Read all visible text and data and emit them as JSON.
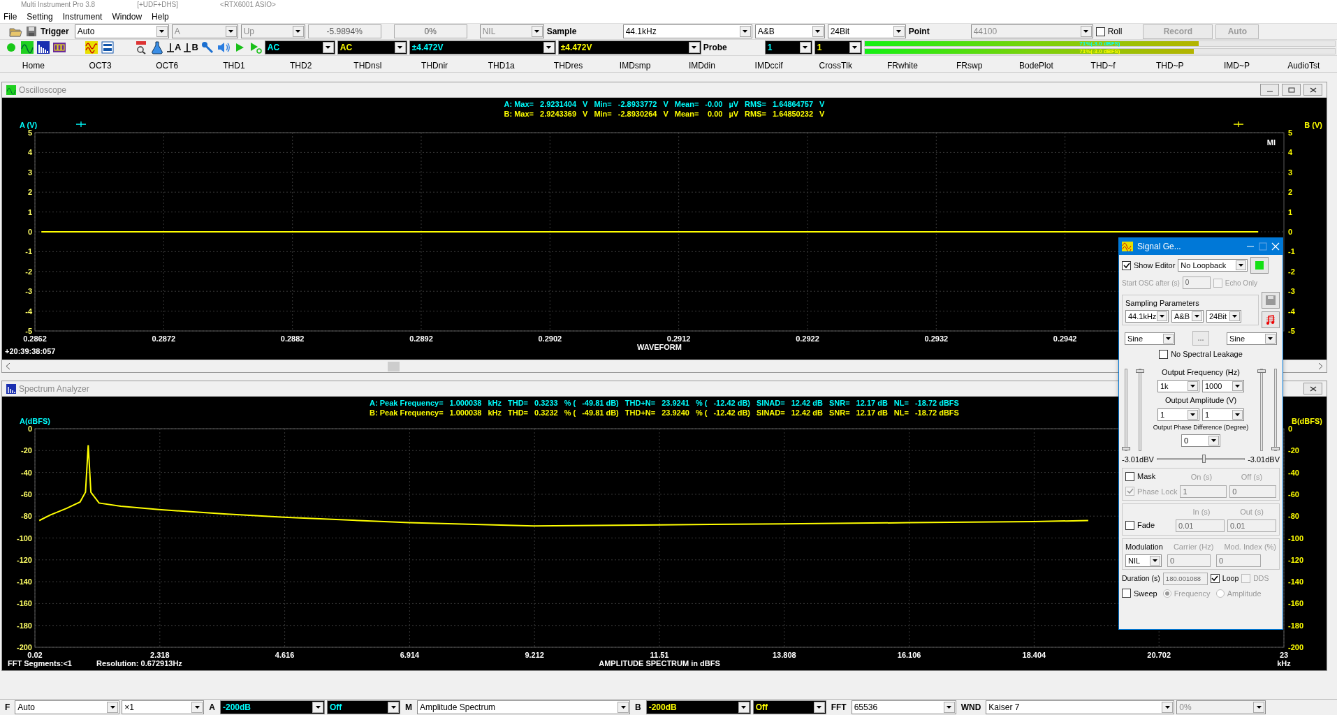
{
  "title_bar": {
    "title": "Multi Instrument Pro 3.8",
    "options": "[+UDF+DHS]",
    "device": "<RTX6001 ASIO>"
  },
  "menu": [
    "File",
    "Setting",
    "Instrument",
    "Window",
    "Help"
  ],
  "toolbar": {
    "trigger_label": "Trigger",
    "items": [
      {
        "kind": "select",
        "value": "Auto",
        "disabled": false
      },
      {
        "kind": "select",
        "value": "A",
        "disabled": true
      },
      {
        "kind": "select",
        "value": "Up",
        "disabled": true
      },
      {
        "kind": "spin",
        "value": "-5.9894%"
      },
      {
        "kind": "spin",
        "value": "0%"
      },
      {
        "kind": "select",
        "value": "NIL",
        "disabled": true
      },
      {
        "kind": "label",
        "value": "Sample"
      },
      {
        "kind": "select",
        "value": "44.1kHz",
        "disabled": false
      },
      {
        "kind": "select",
        "value": "A&B",
        "disabled": false
      },
      {
        "kind": "select",
        "value": "24Bit",
        "disabled": false
      },
      {
        "kind": "label",
        "value": "Point"
      },
      {
        "kind": "select",
        "value": "44100",
        "disabled": true
      }
    ],
    "roll": {
      "label": "Roll",
      "checked": false
    },
    "buttons": [
      {
        "label": "Record",
        "disabled": true
      },
      {
        "label": "Auto",
        "disabled": true
      }
    ]
  },
  "toolbar2": {
    "icons": [
      {
        "kind": "record"
      },
      {
        "kind": "scope"
      },
      {
        "kind": "spectrum"
      },
      {
        "kind": "meter"
      },
      {
        "kind": "generator"
      },
      {
        "kind": "dut"
      },
      {
        "kind": "ddp"
      },
      {
        "kind": "flask"
      },
      {
        "kind": "ground",
        "label": "A"
      },
      {
        "kind": "ground",
        "label": "B"
      },
      {
        "kind": "tool"
      },
      {
        "kind": "speaker"
      },
      {
        "kind": "play"
      },
      {
        "kind": "step"
      }
    ],
    "selects": [
      {
        "value": "AC",
        "color": "#00ffff"
      },
      {
        "value": "AC",
        "color": "#ffff00"
      },
      {
        "value": "±4.472V",
        "color": "#00ffff"
      },
      {
        "value": "±4.472V",
        "color": "#ffff00"
      }
    ],
    "probe_label": "Probe",
    "probes": [
      {
        "value": "1",
        "color": "#00ffff"
      },
      {
        "value": "1",
        "color": "#ffff00"
      }
    ],
    "meters": [
      {
        "level": 0.71,
        "reading": "71%(-3.0 dBFS)",
        "color": "#00ffff"
      },
      {
        "level": 0.7,
        "reading": "71%(-3.0 dBFS)",
        "color": "#ffff00"
      }
    ]
  },
  "tabs": [
    "Home",
    "OCT3",
    "OCT6",
    "THD1",
    "THD2",
    "THDnsl",
    "THDnir",
    "THD1a",
    "THDres",
    "IMDsmp",
    "IMDdin",
    "IMDccif",
    "CrossTlk",
    "FRwhite",
    "FRswp",
    "BodePlot",
    "THD~f",
    "THD~P",
    "IMD~P",
    "AudioTst"
  ],
  "oscilloscope": {
    "title": "Oscilloscope",
    "stats": [
      {
        "color": "#00ffff",
        "cells": [
          "A: Max=",
          "2.9231404",
          "V",
          "Min=",
          "-2.8933772",
          "V",
          "Mean=",
          "-0.00",
          "µV",
          "RMS=",
          "1.64864757",
          "V"
        ]
      },
      {
        "color": "#ffff00",
        "cells": [
          "B: Max=",
          "2.9243369",
          "V",
          "Min=",
          "-2.8930264",
          "V",
          "Mean=",
          "0.00",
          "µV",
          "RMS=",
          "1.64850232",
          "V"
        ]
      }
    ],
    "logo": "MI",
    "timestamp": "+20:39:38:057",
    "right_axis": {
      "label": "B (V)",
      "ticks": [
        "5",
        "4",
        "3",
        "2",
        "1",
        "0",
        "-1",
        "-2",
        "-3",
        "-4",
        "-5"
      ]
    },
    "chart_data": {
      "type": "line",
      "xlabel": "WAVEFORM",
      "ylabel": "A (V)",
      "grid": true,
      "x": [
        0.28625,
        0.2957
      ],
      "series": [
        {
          "color": "#ffff00",
          "values": [
            0,
            0
          ]
        }
      ],
      "xlim": [
        0.2862,
        0.2959
      ],
      "ylim": [
        -5,
        5
      ],
      "xticks": [
        0.2862,
        0.2872,
        0.2882,
        0.2892,
        0.2902,
        0.2912,
        0.2922,
        0.2932,
        0.2942
      ],
      "yticks": [
        5,
        4,
        3,
        2,
        1,
        0,
        -1,
        -2,
        -3,
        -4,
        -5
      ]
    }
  },
  "spectrum": {
    "title": "Spectrum Analyzer",
    "stats": [
      {
        "color": "#00ffff",
        "cells": [
          "A: Peak Frequency=",
          "1.000038",
          "kHz",
          "THD=",
          "0.3233",
          "% (",
          "-49.81 dB)",
          "THD+N=",
          "23.9241",
          "% (",
          "-12.42 dB)",
          "SINAD=",
          "12.42 dB",
          "SNR=",
          "12.17 dB",
          "NL=",
          "-18.72 dBFS"
        ]
      },
      {
        "color": "#ffff00",
        "cells": [
          "B: Peak Frequency=",
          "1.000038",
          "kHz",
          "THD=",
          "0.3232",
          "% (",
          "-49.81 dB)",
          "THD+N=",
          "23.9240",
          "% (",
          "-12.42 dB)",
          "SINAD=",
          "12.42 dB",
          "SNR=",
          "12.17 dB",
          "NL=",
          "-18.72 dBFS"
        ]
      }
    ],
    "unit": "kHz",
    "footer": [
      "FFT Segments:<1",
      "Resolution: 0.672913Hz"
    ],
    "right_axis": {
      "label": "B(dBFS)",
      "ticks": [
        "0",
        "-20",
        "-40",
        "-60",
        "-80",
        "-100",
        "-120",
        "-140",
        "-160",
        "-180",
        "-200"
      ]
    },
    "chart_data": {
      "type": "line",
      "xlabel": "AMPLITUDE SPECTRUM in dBFS",
      "ylabel": "A(dBFS)",
      "grid": true,
      "x": [
        0.1,
        0.3,
        0.6,
        0.85,
        0.95,
        1.0,
        1.05,
        1.2,
        1.6,
        2.3,
        3.5,
        4.6,
        6.9,
        9.2,
        11.5,
        13.8,
        16.1,
        18.4,
        19.4
      ],
      "series": [
        {
          "color": "#ffff00",
          "values": [
            -84,
            -79,
            -73,
            -67,
            -58,
            -15,
            -58,
            -68,
            -71,
            -74,
            -78,
            -81,
            -86,
            -89,
            -88,
            -87,
            -86,
            -85,
            -84
          ]
        }
      ],
      "xlim": [
        0.02,
        23
      ],
      "ylim": [
        -200,
        0
      ],
      "xticks": [
        0.02,
        2.318,
        4.616,
        6.914,
        9.212,
        11.51,
        13.808,
        16.106,
        18.404,
        20.702,
        23
      ],
      "yticks": [
        0,
        -20,
        -40,
        -60,
        -80,
        -100,
        -120,
        -140,
        -160,
        -180,
        -200
      ]
    }
  },
  "signal_generator": {
    "title": "Signal Ge...",
    "show_editor": {
      "label": "Show Editor",
      "checked": true
    },
    "loopback": "No Loopback",
    "start_osc": {
      "label": "Start OSC after (s)",
      "value": "0",
      "disabled": true
    },
    "echo_only": {
      "label": "Echo Only",
      "checked": false,
      "disabled": true
    },
    "sampling": {
      "title": "Sampling Parameters",
      "rate": "44.1kHz",
      "channels": "A&B",
      "bits": "24Bit"
    },
    "waveforms": [
      "Sine",
      "Sine"
    ],
    "more_button": "...",
    "no_spectral_leakage": {
      "label": "No Spectral Leakage",
      "checked": false
    },
    "frequency": {
      "label": "Output Frequency (Hz)",
      "values": [
        "1k",
        "1000"
      ]
    },
    "amplitude": {
      "label": "Output Amplitude (V)",
      "values": [
        "1",
        "1"
      ]
    },
    "phase": {
      "label": "Output Phase Difference (Degree)",
      "value": "0"
    },
    "sliders": [
      {
        "level": 0
      },
      {
        "level": 1
      },
      {
        "level": 1
      },
      {
        "level": 0
      }
    ],
    "levels": [
      "-3.01dBV",
      "-3.01dBV"
    ],
    "balance": {
      "level": 0.52
    },
    "mask": {
      "label": "Mask",
      "checked": false
    },
    "on_label": "On (s)",
    "off_label": "Off (s)",
    "phase_lock": {
      "label": "Phase Lock",
      "checked": true,
      "disabled": true
    },
    "on_value": "1",
    "off_value": "0",
    "fade": {
      "label": "Fade",
      "checked": false
    },
    "in_label": "In (s)",
    "out_label": "Out (s)",
    "in_value": "0.01",
    "out_value": "0.01",
    "modulation": {
      "label": "Modulation",
      "value": "NIL"
    },
    "carrier": {
      "label": "Carrier (Hz)",
      "value": "0"
    },
    "mod_index": {
      "label": "Mod. Index (%)",
      "value": "0"
    },
    "duration": {
      "label": "Duration (s)",
      "value": "180.001088"
    },
    "loop": {
      "label": "Loop",
      "checked": true,
      "disabled": false
    },
    "dds": {
      "label": "DDS",
      "checked": false,
      "disabled": true
    },
    "sweep": {
      "label": "Sweep",
      "checked": false
    },
    "sweep_modes": [
      {
        "label": "Frequency",
        "selected": true
      },
      {
        "label": "Amplitude",
        "selected": false
      }
    ]
  },
  "bottom_bar": [
    {
      "kind": "label",
      "value": "F"
    },
    {
      "kind": "select",
      "value": "Auto"
    },
    {
      "kind": "select",
      "value": "×1"
    },
    {
      "kind": "label",
      "value": "A"
    },
    {
      "kind": "select",
      "value": "-200dB",
      "color": "#00ffff"
    },
    {
      "kind": "select",
      "value": "Off",
      "color": "#00ffff"
    },
    {
      "kind": "label",
      "value": "M"
    },
    {
      "kind": "select",
      "value": "Amplitude Spectrum"
    },
    {
      "kind": "label",
      "value": "B"
    },
    {
      "kind": "select",
      "value": "-200dB",
      "color": "#ffff00"
    },
    {
      "kind": "select",
      "value": "Off",
      "color": "#ffff00"
    },
    {
      "kind": "label",
      "value": "FFT"
    },
    {
      "kind": "select",
      "value": "65536"
    },
    {
      "kind": "label",
      "value": "WND"
    },
    {
      "kind": "select",
      "value": "Kaiser 7"
    },
    {
      "kind": "select",
      "value": "0%",
      "disabled": true
    }
  ]
}
